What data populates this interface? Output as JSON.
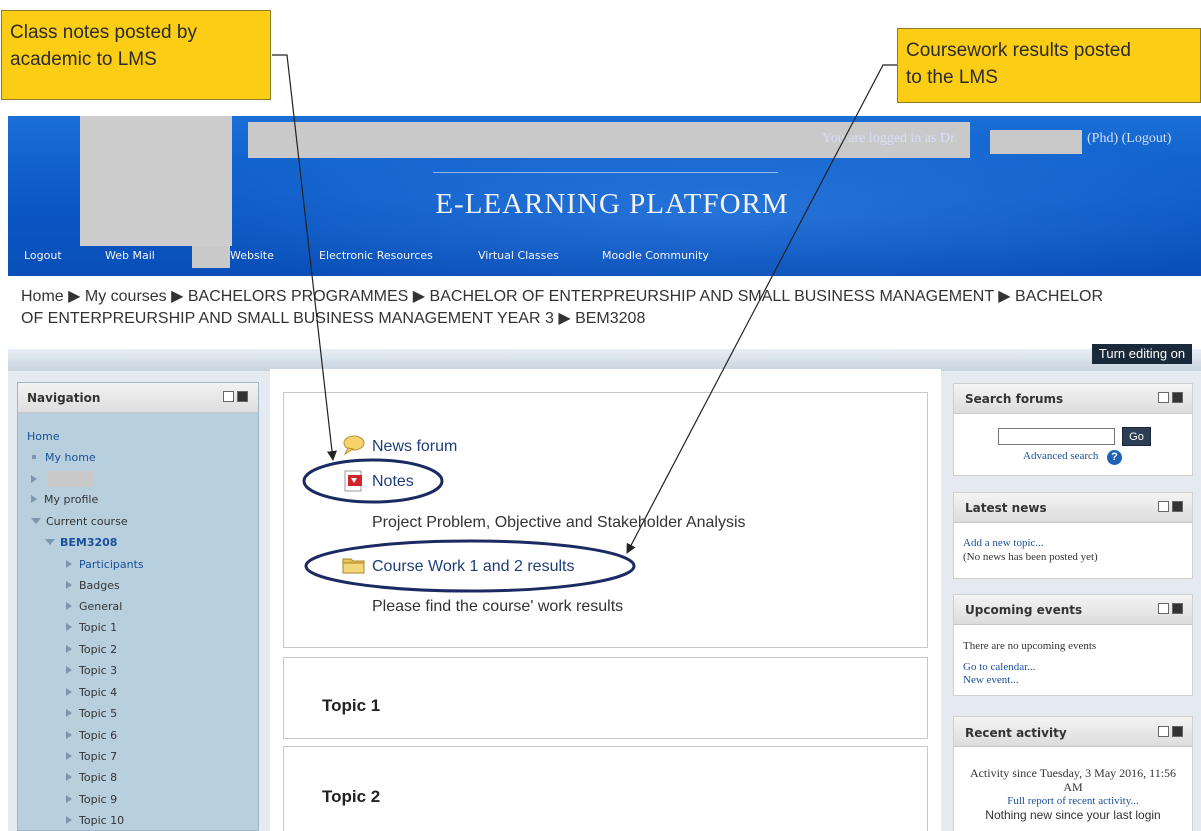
{
  "callouts": {
    "left": [
      "Class notes posted by",
      "academic to LMS"
    ],
    "right": [
      "Coursework results posted",
      "to the LMS"
    ]
  },
  "header": {
    "title": "E-LEARNING PLATFORM",
    "nav": [
      "Logout",
      "Web Mail",
      "Website",
      "Electronic Resources",
      "Virtual Classes",
      "Moodle Community"
    ],
    "login_prefix": "You are logged in as Dr.",
    "login_suffix": "(Phd) (Logout)"
  },
  "breadcrumb": {
    "line1": "Home ▶ My courses ▶ BACHELORS PROGRAMMES ▶ BACHELOR OF ENTERPREURSHIP AND SMALL BUSINESS MANAGEMENT ▶ BACHELOR",
    "line2": "OF ENTERPREURSHIP AND SMALL BUSINESS MANAGEMENT YEAR 3 ▶ BEM3208"
  },
  "editing_button": "Turn editing on",
  "navigation": {
    "title": "Navigation",
    "home": "Home",
    "my_home": "My home",
    "my_profile": "My profile",
    "current_course": "Current course",
    "course": "BEM3208",
    "items": [
      "Participants",
      "Badges",
      "General",
      "Topic 1",
      "Topic 2",
      "Topic 3",
      "Topic 4",
      "Topic 5",
      "Topic 6",
      "Topic 7",
      "Topic 8",
      "Topic 9",
      "Topic 10"
    ]
  },
  "main": {
    "news_forum": "News forum",
    "notes": "Notes",
    "notes_desc": "Project Problem, Objective and Stakeholder Analysis",
    "coursework": "Course Work 1 and 2 results",
    "coursework_desc": "Please find the course' work results",
    "topic1": "Topic 1",
    "topic2": "Topic 2"
  },
  "right": {
    "search": {
      "title": "Search forums",
      "go": "Go",
      "advanced": "Advanced search",
      "help": "?"
    },
    "latest_news": {
      "title": "Latest news",
      "add": "Add a new topic...",
      "none": "(No news has been posted yet)"
    },
    "upcoming": {
      "title": "Upcoming events",
      "none": "There are no upcoming events",
      "calendar": "Go to calendar...",
      "new_event": "New event..."
    },
    "recent": {
      "title": "Recent activity",
      "since1": "Activity since Tuesday, 3 May 2016, 11:56",
      "since2": "AM",
      "report": "Full report of recent activity...",
      "nothing": "Nothing new since your last login"
    }
  },
  "colors": {
    "header_blue": "#0a56c4",
    "callout_yellow": "#fbcd15",
    "annotation_navy": "#1c2a63",
    "nav_panel": "#b8cfdd"
  },
  "icons": {
    "forum": "speech-bubble-icon",
    "notes": "pdf-file-icon",
    "folder": "folder-icon",
    "help": "help-icon"
  }
}
